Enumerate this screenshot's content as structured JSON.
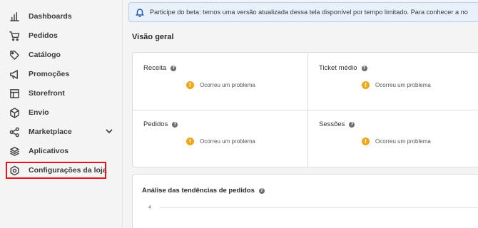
{
  "sidebar": {
    "items": [
      {
        "label": "Dashboards",
        "icon": "bar-chart-icon"
      },
      {
        "label": "Pedidos",
        "icon": "cart-icon"
      },
      {
        "label": "Catálogo",
        "icon": "tag-icon"
      },
      {
        "label": "Promoções",
        "icon": "megaphone-icon"
      },
      {
        "label": "Storefront",
        "icon": "layout-icon"
      },
      {
        "label": "Envio",
        "icon": "box-icon"
      },
      {
        "label": "Marketplace",
        "icon": "share-icon"
      },
      {
        "label": "Aplicativos",
        "icon": "layers-icon"
      },
      {
        "label": "Configurações da loja",
        "icon": "gear-icon"
      }
    ],
    "highlight_color": "#e8141c"
  },
  "banner": {
    "text": "Participe do beta: temos uma versão atualizada dessa tela disponível por tempo limitado. Para conhecer a no"
  },
  "overview": {
    "title": "Visão geral",
    "metrics": [
      {
        "label": "Receita",
        "error": "Ocorreu um problema"
      },
      {
        "label": "Ticket médio",
        "error": "Ocorreu um problema"
      },
      {
        "label": "Pedidos",
        "error": "Ocorreu um problema"
      },
      {
        "label": "Sessões",
        "error": "Ocorreu um problema"
      }
    ],
    "help_glyph": "?",
    "warn_glyph": "!"
  },
  "trends": {
    "title": "Análise das tendências de pedidos",
    "y_tick": "4"
  },
  "colors": {
    "accent": "#2a5db0",
    "warning": "#f2a516"
  }
}
